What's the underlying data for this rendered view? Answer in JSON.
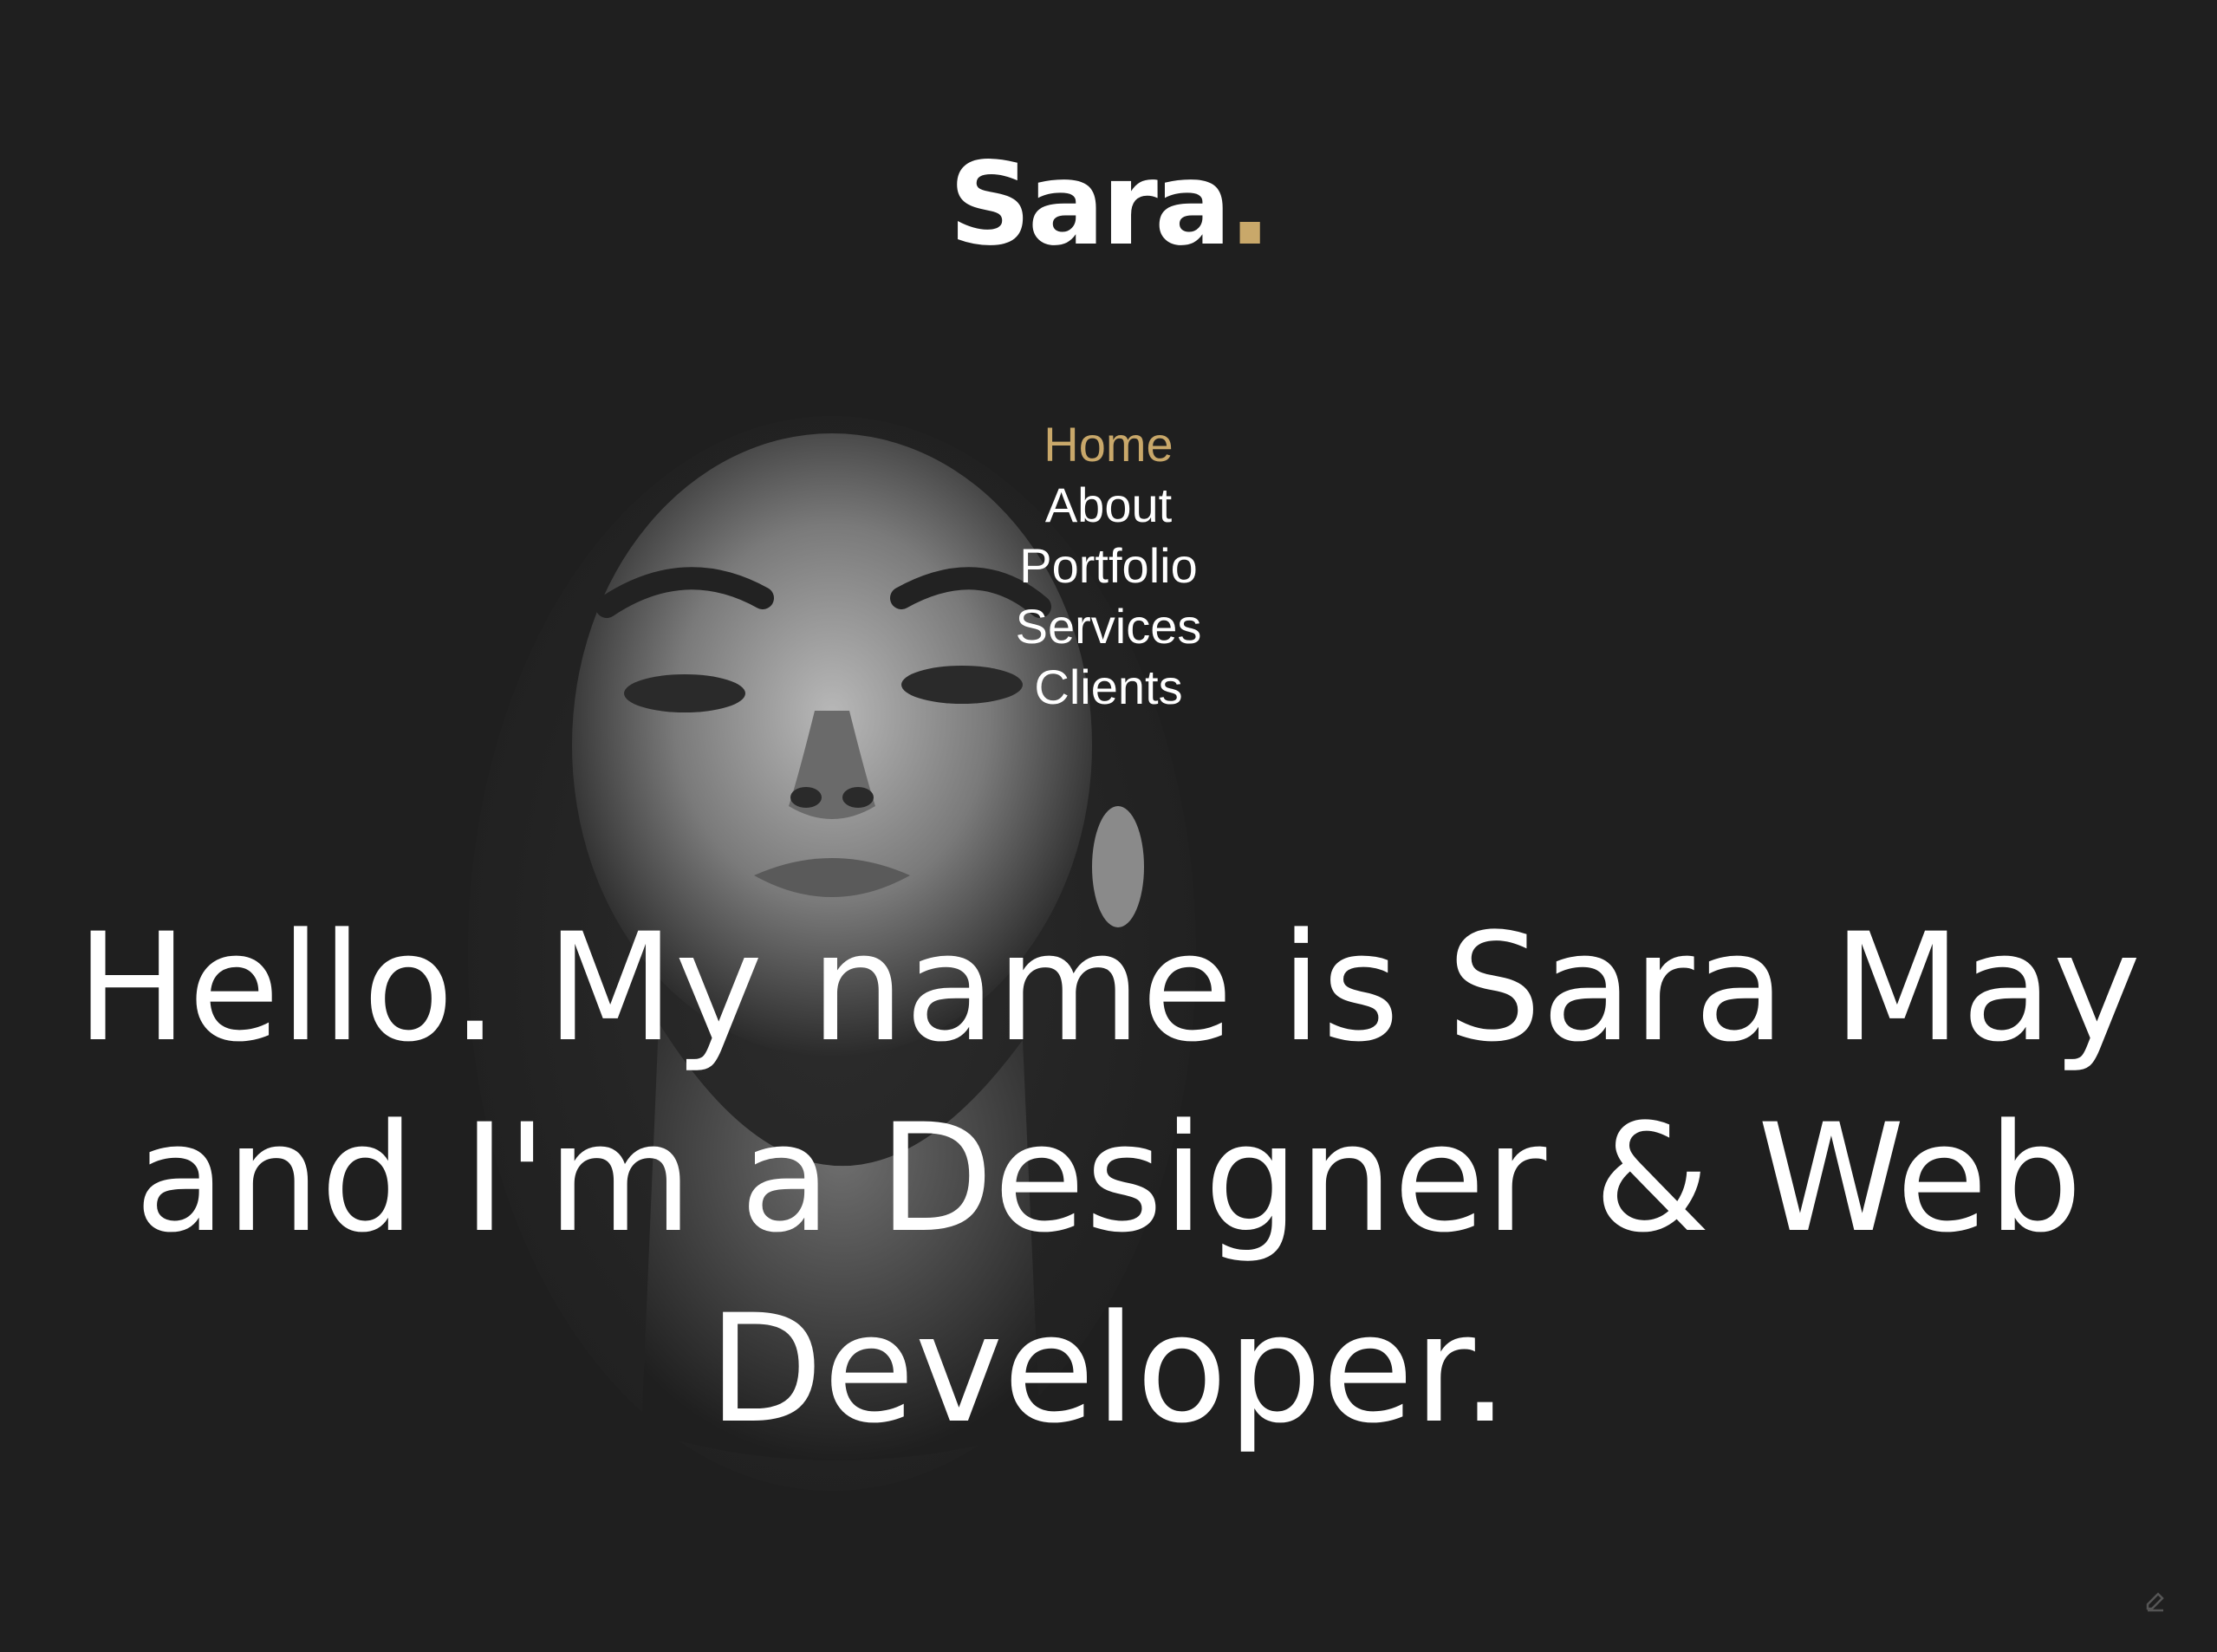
{
  "brand": {
    "name": "Sara",
    "dot": ".",
    "accent_color": "#c9a86a"
  },
  "nav": {
    "items": [
      {
        "label": "Home",
        "active": true
      },
      {
        "label": "About",
        "active": false
      },
      {
        "label": "Portfolio",
        "active": false
      },
      {
        "label": "Services",
        "active": false
      },
      {
        "label": "Clients",
        "active": false
      }
    ]
  },
  "hero": {
    "headline": "Hello. My name is Sara May and I'm a Designer & Web Developer.",
    "background_image": "portrait-photo",
    "background_color": "#1f1f1f"
  },
  "corner": {
    "icon": "edit-icon"
  }
}
